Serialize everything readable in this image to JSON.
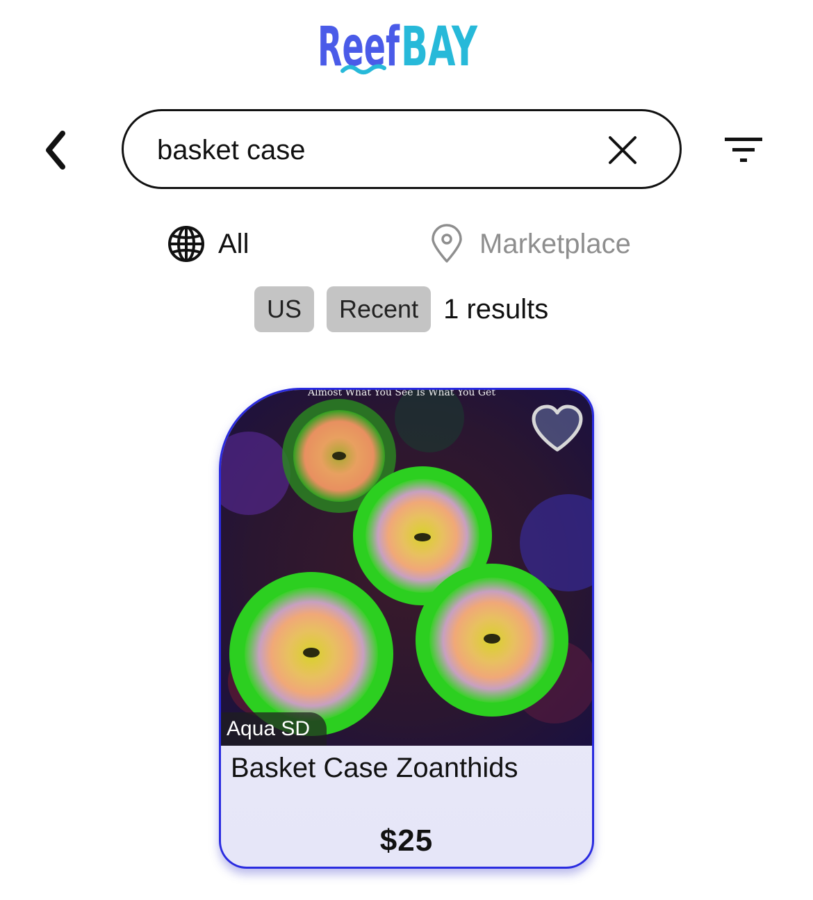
{
  "brand": {
    "logo_text_left": "Reef",
    "logo_text_right": "BAY",
    "left_color": "#4a5be8",
    "right_color": "#27b9d9"
  },
  "search": {
    "value": "basket case",
    "back_icon": "chevron-left-icon",
    "clear_icon": "close-icon",
    "filter_icon": "filter-icon"
  },
  "scope": {
    "all_label": "All",
    "all_icon": "globe-icon",
    "marketplace_label": "Marketplace",
    "marketplace_icon": "map-pin-icon"
  },
  "filters": {
    "chips": [
      "US",
      "Recent"
    ],
    "results_text": "1 results"
  },
  "listing": {
    "seller": "Aqua SD",
    "title": "Basket Case Zoanthids",
    "price": "$25",
    "favorite_icon": "heart-icon",
    "image_subject": "zoanthid coral photo",
    "image_caption": "Almost What You See Is What You Get",
    "accent_color": "#2a2be0"
  }
}
